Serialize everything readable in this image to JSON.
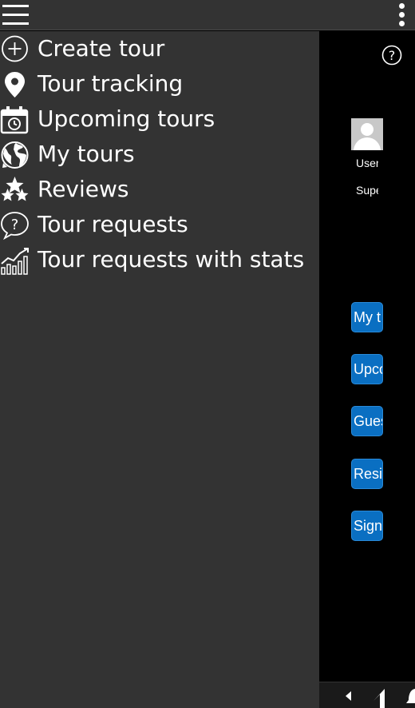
{
  "drawer": {
    "items": [
      {
        "label": "Create tour",
        "icon": "plus-circle-icon"
      },
      {
        "label": "Tour tracking",
        "icon": "map-pin-icon"
      },
      {
        "label": "Upcoming tours",
        "icon": "calendar-clock-icon"
      },
      {
        "label": "My tours",
        "icon": "globe-icon"
      },
      {
        "label": "Reviews",
        "icon": "stars-icon"
      },
      {
        "label": "Tour requests",
        "icon": "question-bubble-icon"
      },
      {
        "label": "Tour requests with stats",
        "icon": "stats-chart-icon"
      }
    ]
  },
  "background": {
    "user_name": "User",
    "user_role": "Supe",
    "buttons": [
      "My t",
      "Upco",
      "Gues",
      "Resig",
      "Sign"
    ]
  },
  "colors": {
    "drawer_bg": "#333333",
    "content_bg": "#000000",
    "button_blue": "#0a6fc2"
  }
}
